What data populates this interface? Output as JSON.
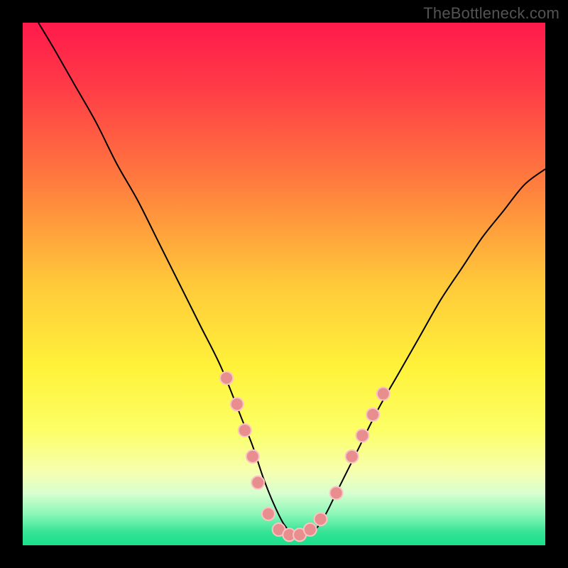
{
  "watermark": "TheBottleneck.com",
  "chart_data": {
    "type": "line",
    "title": "",
    "xlabel": "",
    "ylabel": "",
    "xlim": [
      0,
      100
    ],
    "ylim": [
      0,
      100
    ],
    "grid": false,
    "background": {
      "type": "vertical-gradient",
      "stops": [
        {
          "pos": 0.0,
          "color": "#ff1a4b"
        },
        {
          "pos": 0.12,
          "color": "#ff3a47"
        },
        {
          "pos": 0.3,
          "color": "#ff7a3e"
        },
        {
          "pos": 0.5,
          "color": "#ffc93a"
        },
        {
          "pos": 0.66,
          "color": "#fff23a"
        },
        {
          "pos": 0.78,
          "color": "#fcff66"
        },
        {
          "pos": 0.86,
          "color": "#f6ffb0"
        },
        {
          "pos": 0.9,
          "color": "#d8ffcf"
        },
        {
          "pos": 0.94,
          "color": "#8cf7b8"
        },
        {
          "pos": 0.975,
          "color": "#35e396"
        },
        {
          "pos": 1.0,
          "color": "#1adf8b"
        }
      ]
    },
    "series": [
      {
        "name": "bottleneck-curve",
        "color": "#000000",
        "stroke_width": 2,
        "x": [
          3,
          6,
          10,
          14,
          18,
          22,
          26,
          30,
          34,
          38,
          42,
          44,
          46,
          48,
          50,
          52,
          54,
          56,
          58,
          60,
          64,
          68,
          72,
          76,
          80,
          84,
          88,
          92,
          96,
          100
        ],
        "y": [
          100,
          95,
          88,
          81,
          73,
          66,
          58,
          50,
          42,
          34,
          24,
          19,
          13,
          8,
          4,
          2,
          2,
          3,
          6,
          10,
          18,
          26,
          33,
          40,
          47,
          53,
          59,
          64,
          69,
          72
        ]
      }
    ],
    "markers": {
      "name": "highlighted-points",
      "color": "#e98e8e",
      "border": "#f8c4c4",
      "radius": 9,
      "points": [
        {
          "x": 39,
          "y": 32
        },
        {
          "x": 41,
          "y": 27
        },
        {
          "x": 42.5,
          "y": 22
        },
        {
          "x": 44,
          "y": 17
        },
        {
          "x": 45,
          "y": 12
        },
        {
          "x": 47,
          "y": 6
        },
        {
          "x": 49,
          "y": 3
        },
        {
          "x": 51,
          "y": 2
        },
        {
          "x": 53,
          "y": 2
        },
        {
          "x": 55,
          "y": 3
        },
        {
          "x": 57,
          "y": 5
        },
        {
          "x": 60,
          "y": 10
        },
        {
          "x": 63,
          "y": 17
        },
        {
          "x": 65,
          "y": 21
        },
        {
          "x": 67,
          "y": 25
        },
        {
          "x": 69,
          "y": 29
        }
      ]
    }
  }
}
